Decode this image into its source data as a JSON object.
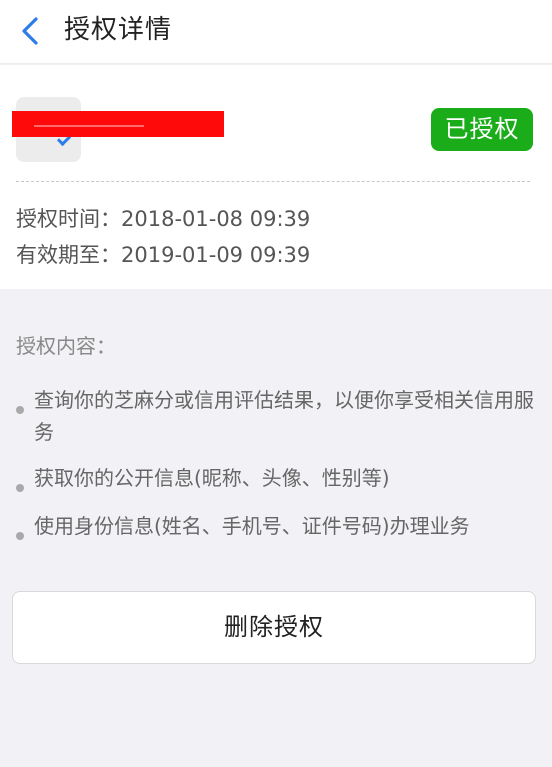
{
  "nav": {
    "back_icon": "chevron-left-icon",
    "title": "授权详情",
    "accent": "#2d7de8"
  },
  "card": {
    "app_logo_icon": "app-logo-icon",
    "app_name_redacted": true,
    "status_badge": "已授权",
    "status_color": "#1aad19",
    "auth_time": "授权时间：2018-01-08 09:39",
    "valid_until": "有效期至：2019-01-09 09:39"
  },
  "permissions": {
    "title": "授权内容：",
    "items": [
      "查询你的芝麻分或信用评估结果，以便你享受相关信用服务",
      "获取你的公开信息(昵称、头像、性别等)",
      "使用身份信息(姓名、手机号、证件号码)办理业务"
    ]
  },
  "actions": {
    "delete_label": "删除授权"
  }
}
